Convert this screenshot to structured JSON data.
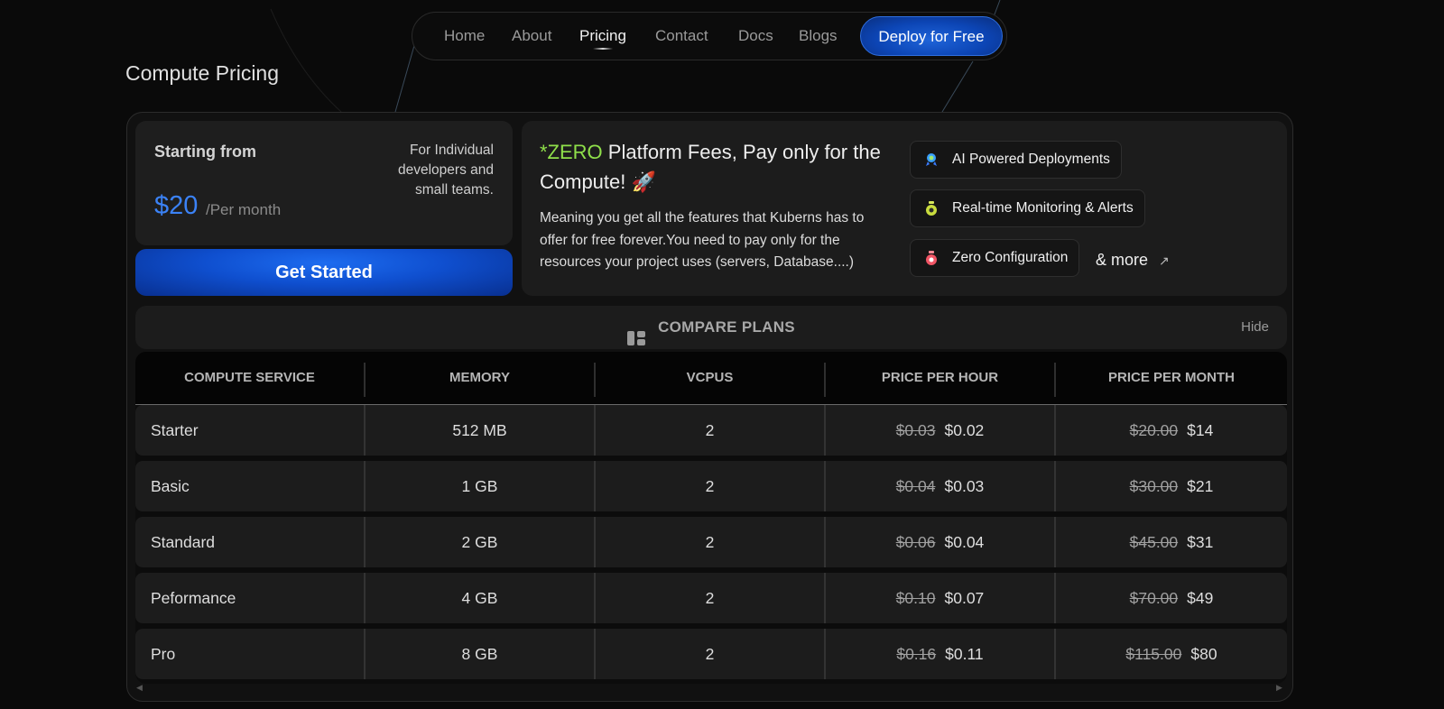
{
  "nav": {
    "links": [
      "Home",
      "About",
      "Pricing",
      "Contact",
      "Docs",
      "Blogs"
    ],
    "active": "Pricing",
    "cta": "Deploy for Free"
  },
  "page_title": "Compute Pricing",
  "pricing": {
    "starting_from": "Starting from",
    "description": "For Individual developers and small teams.",
    "amount": "$20",
    "period": "/Per month",
    "get_started": "Get Started"
  },
  "info": {
    "accent": "*ZERO",
    "title_rest": " Platform Fees, Pay only for the Compute! 🚀",
    "description": "Meaning you get all the features that Kuberns has to offer for free forever.You need to pay only for the resources your project uses (servers, Database....)",
    "features": [
      {
        "label": "AI Powered Deployments",
        "icon": "ai-badge-icon"
      },
      {
        "label": "Real-time Monitoring & Alerts",
        "icon": "monitor-icon"
      },
      {
        "label": "Zero Configuration",
        "icon": "config-icon"
      }
    ],
    "more": "& more",
    "more_icon": "arrow-up-right-icon"
  },
  "compare": {
    "label": "COMPARE PLANS",
    "hide": "Hide"
  },
  "table": {
    "headers": [
      "COMPUTE SERVICE",
      "MEMORY",
      "VCPUS",
      "PRICE PER HOUR",
      "PRICE PER MONTH"
    ],
    "rows": [
      {
        "service": "Starter",
        "memory": "512 MB",
        "vcpus": "2",
        "hour_old": "$0.03",
        "hour_new": "$0.02",
        "month_old": "$20.00",
        "month_new": "$14"
      },
      {
        "service": "Basic",
        "memory": "1 GB",
        "vcpus": "2",
        "hour_old": "$0.04",
        "hour_new": "$0.03",
        "month_old": "$30.00",
        "month_new": "$21"
      },
      {
        "service": "Standard",
        "memory": "2 GB",
        "vcpus": "2",
        "hour_old": "$0.06",
        "hour_new": "$0.04",
        "month_old": "$45.00",
        "month_new": "$31"
      },
      {
        "service": "Peformance",
        "memory": "4 GB",
        "vcpus": "2",
        "hour_old": "$0.10",
        "hour_new": "$0.07",
        "month_old": "$70.00",
        "month_new": "$49"
      },
      {
        "service": "Pro",
        "memory": "8 GB",
        "vcpus": "2",
        "hour_old": "$0.16",
        "hour_new": "$0.11",
        "month_old": "$115.00",
        "month_new": "$80"
      }
    ]
  },
  "colors": {
    "accent_blue": "#3b82f6",
    "accent_green": "#8fe04a",
    "background": "#0a0a0a"
  }
}
